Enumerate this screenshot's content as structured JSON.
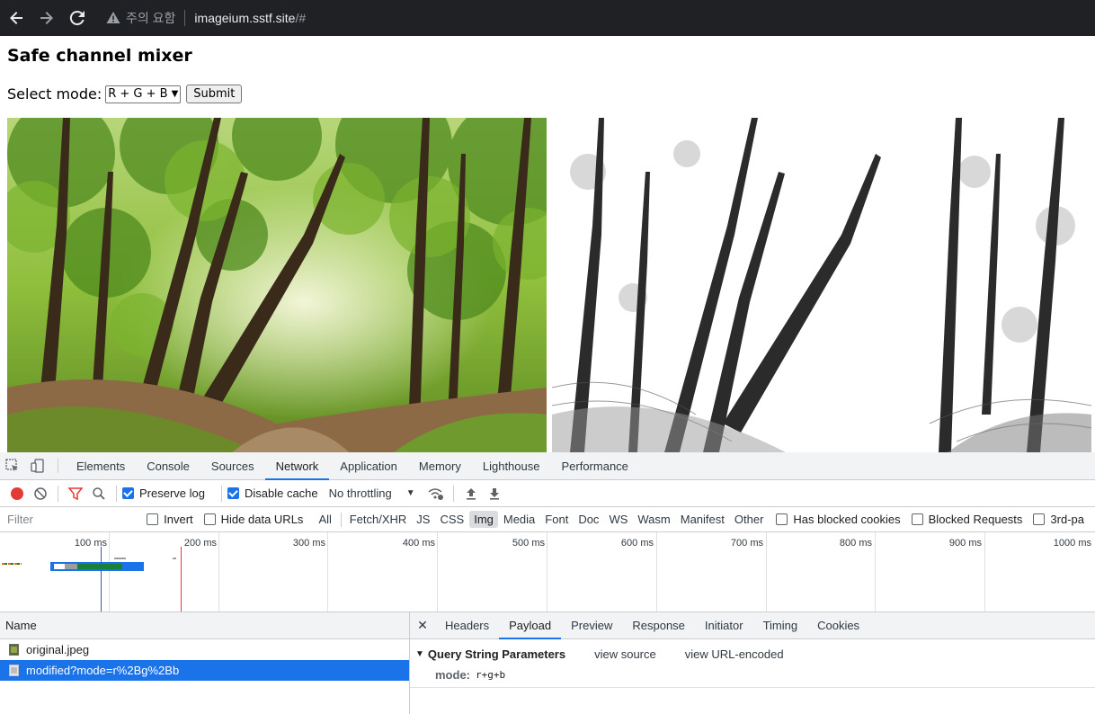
{
  "browser": {
    "security_warning": "주의 요함",
    "url_host": "imageium.sstf.site",
    "url_path": "/#"
  },
  "page": {
    "title": "Safe channel mixer",
    "mode_label": "Select mode:",
    "mode_selected": "R + G + B",
    "submit_label": "Submit"
  },
  "devtools": {
    "tabs": [
      "Elements",
      "Console",
      "Sources",
      "Network",
      "Application",
      "Memory",
      "Lighthouse",
      "Performance"
    ],
    "active_tab": "Network",
    "toolbar": {
      "preserve_log": "Preserve log",
      "disable_cache": "Disable cache",
      "throttling": "No throttling"
    },
    "filter": {
      "placeholder": "Filter",
      "invert": "Invert",
      "hide_data_urls": "Hide data URLs",
      "types": [
        "All",
        "Fetch/XHR",
        "JS",
        "CSS",
        "Img",
        "Media",
        "Font",
        "Doc",
        "WS",
        "Wasm",
        "Manifest",
        "Other"
      ],
      "active_type": "Img",
      "has_blocked_cookies": "Has blocked cookies",
      "blocked_requests": "Blocked Requests",
      "third_party": "3rd-pa"
    },
    "timeline_ticks": [
      "100 ms",
      "200 ms",
      "300 ms",
      "400 ms",
      "500 ms",
      "600 ms",
      "700 ms",
      "800 ms",
      "900 ms",
      "1000 ms"
    ],
    "name_header": "Name",
    "requests": [
      {
        "name": "original.jpeg"
      },
      {
        "name": "modified?mode=r%2Bg%2Bb"
      }
    ],
    "detail_tabs": [
      "Headers",
      "Payload",
      "Preview",
      "Response",
      "Initiator",
      "Timing",
      "Cookies"
    ],
    "active_detail_tab": "Payload",
    "payload": {
      "section_title": "Query String Parameters",
      "view_source": "view source",
      "view_url_encoded": "view URL-encoded",
      "params": [
        {
          "key": "mode:",
          "value": "r+g+b"
        }
      ]
    }
  }
}
